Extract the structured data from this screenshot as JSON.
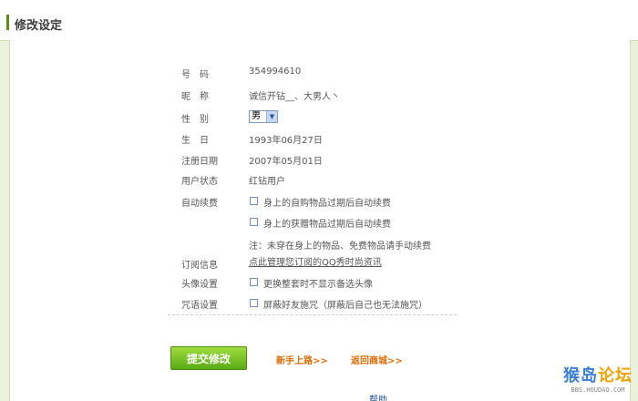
{
  "header": {
    "title": "修改设定"
  },
  "fields": {
    "qq_label": "号　码",
    "qq_value": "354994610",
    "nickname_label": "昵　称",
    "nickname_value": "诚信开钻__、大男人丶",
    "gender_label": "性　别",
    "gender_value": "男",
    "birthday_label": "生　日",
    "birthday_value": "1993年06月27日",
    "regdate_label": "注册日期",
    "regdate_value": "2007年05月01日",
    "status_label": "用户状态",
    "status_value": "红钻用户",
    "renew_label": "自动续费",
    "renew_option1": "身上的自购物品过期后自动续费",
    "renew_option2": "身上的获赠物品过期后自动续费",
    "renew_note": "注：未穿在身上的物品、免费物品请手动续费",
    "subscribe_label": "订阅信息",
    "subscribe_link": "点此管理您订阅的QQ秀时尚资讯",
    "avatar_label": "头像设置",
    "avatar_option": "更换整套时不显示备选头像",
    "curse_label": "咒语设置",
    "curse_option": "屏蔽好友施咒（屏蔽后自己也无法施咒）"
  },
  "actions": {
    "submit_label": "提交修改",
    "newbie_link": "新手上路>>",
    "back_link": "返回商城>>"
  },
  "footer": {
    "partial_text": "……………………………………………………………………帮助"
  },
  "watermark": {
    "main_a": "猴岛",
    "main_b": "论坛",
    "sub": "BBS.HOUDAO.COM"
  },
  "colors": {
    "accent_green": "#5a8f1a",
    "panel_bg": "#eaf2dc",
    "link_orange": "#e06a00"
  }
}
